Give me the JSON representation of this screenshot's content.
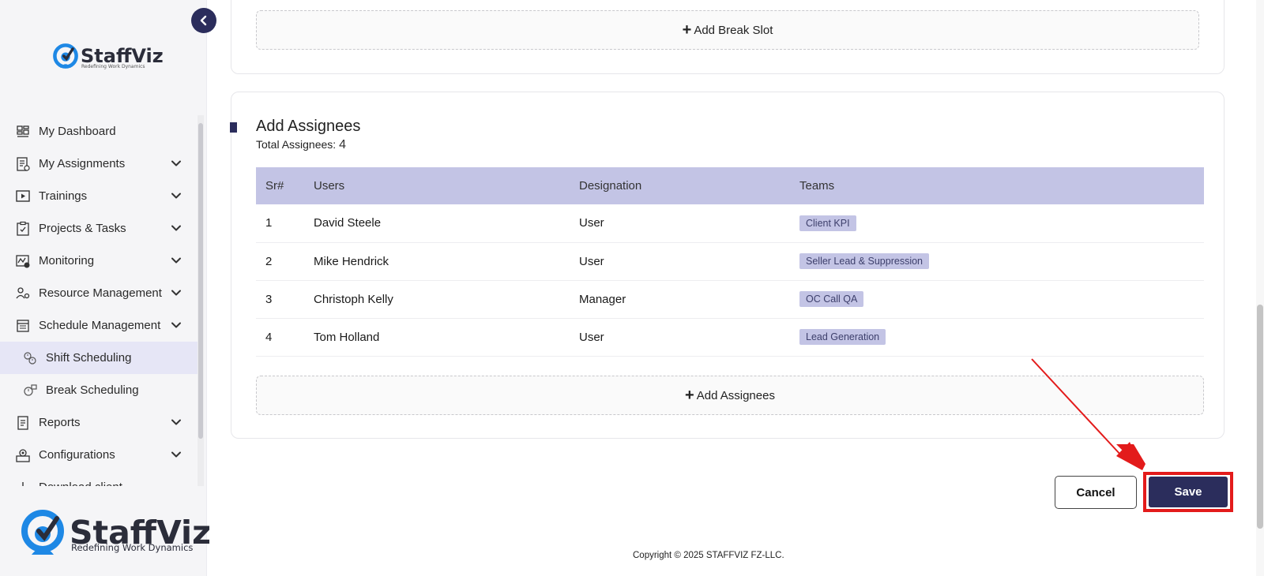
{
  "brand": {
    "name": "StaffViz",
    "tagline_small": "Redefining Work Dynamics",
    "tagline": "Redefining Work Dynamics",
    "accent": "#2b2d5c",
    "logo_blue": "#1e88e5"
  },
  "sidebar": {
    "items": [
      {
        "label": "My Dashboard",
        "icon": "dashboard-icon",
        "expandable": false
      },
      {
        "label": "My Assignments",
        "icon": "assignments-icon",
        "expandable": true
      },
      {
        "label": "Trainings",
        "icon": "play-icon",
        "expandable": true
      },
      {
        "label": "Projects & Tasks",
        "icon": "clipboard-icon",
        "expandable": true
      },
      {
        "label": "Monitoring",
        "icon": "monitoring-icon",
        "expandable": true
      },
      {
        "label": "Resource Management",
        "icon": "resource-icon",
        "expandable": true
      },
      {
        "label": "Schedule Management",
        "icon": "calendar-icon",
        "expandable": true
      },
      {
        "label": "Shift Scheduling",
        "icon": "shift-icon",
        "expandable": false,
        "active": true
      },
      {
        "label": "Break Scheduling",
        "icon": "break-icon",
        "expandable": false
      },
      {
        "label": "Reports",
        "icon": "reports-icon",
        "expandable": true
      },
      {
        "label": "Configurations",
        "icon": "config-icon",
        "expandable": true
      },
      {
        "label": "Download client",
        "icon": "download-icon",
        "expandable": false
      }
    ]
  },
  "break_section": {
    "add_break_label": "Add Break Slot"
  },
  "assignees_section": {
    "title": "Add Assignees",
    "total_label": "Total Assignees:",
    "total_value": "4",
    "columns": [
      "Sr#",
      "Users",
      "Designation",
      "Teams"
    ],
    "rows": [
      {
        "sr": "1",
        "user": "David Steele",
        "designation": "User",
        "team": "Client KPI"
      },
      {
        "sr": "2",
        "user": "Mike Hendrick",
        "designation": "User",
        "team": "Seller Lead & Suppression"
      },
      {
        "sr": "3",
        "user": "Christoph Kelly",
        "designation": "Manager",
        "team": "OC Call QA"
      },
      {
        "sr": "4",
        "user": "Tom Holland",
        "designation": "User",
        "team": "Lead Generation"
      }
    ],
    "add_assignees_label": "Add Assignees"
  },
  "actions": {
    "cancel_label": "Cancel",
    "save_label": "Save",
    "highlight_color": "#e31b1b"
  },
  "footer": {
    "copyright": "Copyright © 2025 STAFFVIZ FZ-LLC."
  }
}
